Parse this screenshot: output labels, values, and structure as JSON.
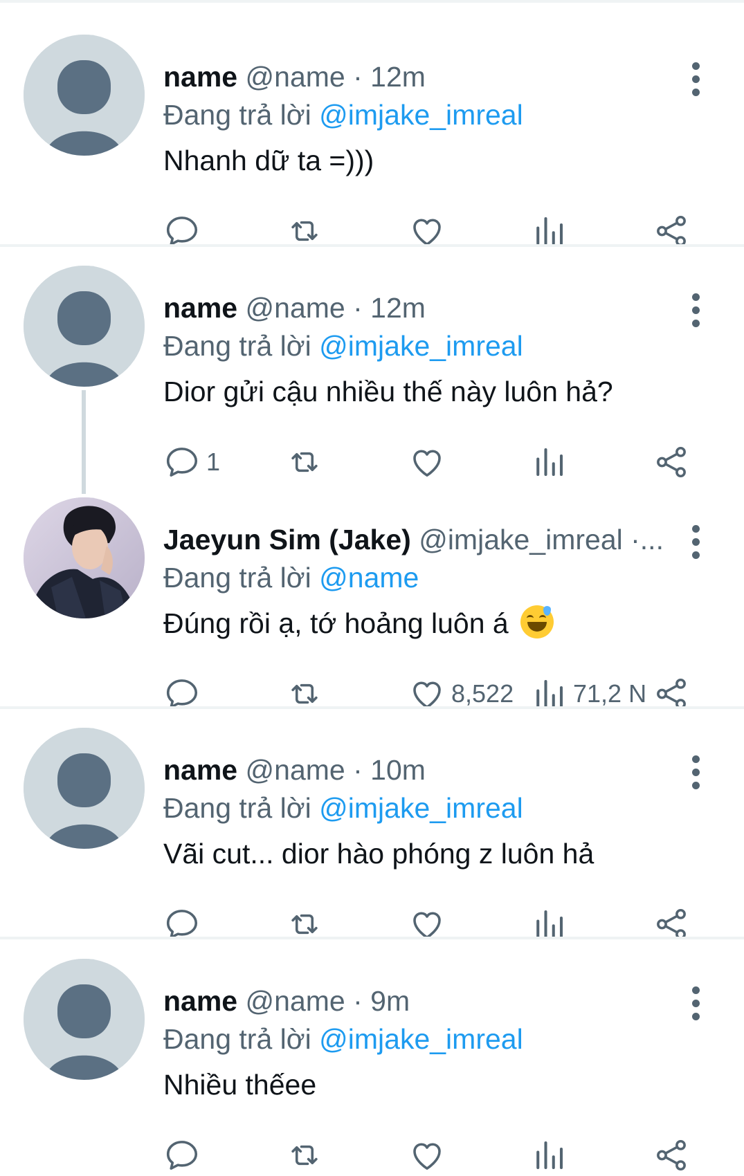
{
  "colors": {
    "accent": "#1d9bf0",
    "text": "#0f1419",
    "muted": "#536471",
    "divider": "#eff3f4",
    "avatar_placeholder": "#cfd9de"
  },
  "tweets": [
    {
      "name": "name",
      "handle": "@name",
      "separator": "·",
      "time": "12m",
      "replying_prefix": "Đang trả lời",
      "replying_to": "@imjake_imreal",
      "text": "Nhanh dữ ta =)))",
      "reply_count": "",
      "like_count": "",
      "view_count": ""
    },
    {
      "name": "name",
      "handle": "@name",
      "separator": "·",
      "time": "12m",
      "replying_prefix": "Đang trả lời",
      "replying_to": "@imjake_imreal",
      "text": "Dior gửi cậu nhiều thế này luôn hả?",
      "reply_count": "1",
      "like_count": "",
      "view_count": ""
    },
    {
      "name": "Jaeyun Sim (Jake)",
      "handle": "@imjake_imreal",
      "separator": "·...",
      "time": "",
      "replying_prefix": "Đang trả lời",
      "replying_to": "@name",
      "text": "Đúng rồi ạ, tớ hoảng luôn á",
      "emoji": "grinning-face-with-sweat",
      "reply_count": "",
      "like_count": "8,522",
      "view_count": "71,2 N"
    },
    {
      "name": "name",
      "handle": "@name",
      "separator": "·",
      "time": "10m",
      "replying_prefix": "Đang trả lời",
      "replying_to": "@imjake_imreal",
      "text": "Vãi cut... dior hào phóng z luôn hả",
      "reply_count": "",
      "like_count": "",
      "view_count": ""
    },
    {
      "name": "name",
      "handle": "@name",
      "separator": "·",
      "time": "9m",
      "replying_prefix": "Đang trả lời",
      "replying_to": "@imjake_imreal",
      "text": "Nhiều thếee",
      "reply_count": "",
      "like_count": "",
      "view_count": ""
    }
  ],
  "icons": {
    "reply": "reply-icon",
    "retweet": "retweet-icon",
    "like": "heart-icon",
    "views": "views-icon",
    "share": "share-icon",
    "more": "more-vertical-icon"
  }
}
